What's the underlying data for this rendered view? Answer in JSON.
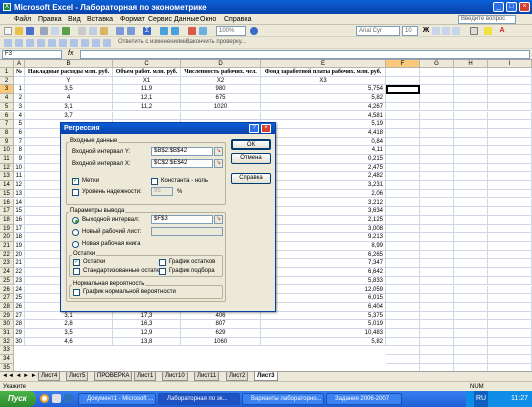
{
  "window": {
    "title": "Microsoft Excel - Лабораторная по эконометрике"
  },
  "menu": [
    "Файл",
    "Правка",
    "Вид",
    "Вставка",
    "Формат",
    "Сервис",
    "Данные",
    "Окно",
    "Справка"
  ],
  "help_placeholder": "Введите вопрос",
  "toolbar": {
    "font": "Arial Cyr",
    "size": "10",
    "review_label": "Ответить с изменениями...",
    "finish_label": "Закончить проверку..."
  },
  "formula": {
    "name_box": "F3",
    "fx": "fx",
    "value": ""
  },
  "columns": [
    "A",
    "B",
    "C",
    "D",
    "E",
    "F",
    "G",
    "H",
    "I"
  ],
  "selected_col": "F",
  "selected_row": 3,
  "header_row": {
    "a": "№",
    "b": "Накладные расходы млн. руб.",
    "c": "Объем работ. млн. руб.",
    "d": "Численность рабочих. чел.",
    "e": "Фонд заработной платы рабочих. млн. руб."
  },
  "var_row": {
    "b": "Y",
    "c": "X1",
    "d": "X2",
    "e": "X3"
  },
  "rows": [
    {
      "r": 3,
      "a": "1",
      "b": "3,5",
      "c": "11,9",
      "d": "980",
      "e": "5,754"
    },
    {
      "r": 4,
      "a": "2",
      "b": "4",
      "c": "12,1",
      "d": "675",
      "e": "5,82"
    },
    {
      "r": 5,
      "a": "3",
      "b": "3,1",
      "c": "11,2",
      "d": "1020",
      "e": "4,267"
    },
    {
      "r": 6,
      "a": "4",
      "b": "3,7",
      "c": "",
      "d": "",
      "e": "4,581"
    },
    {
      "r": 7,
      "a": "5",
      "b": "",
      "c": "",
      "d": "",
      "e": "5,19"
    },
    {
      "r": 8,
      "a": "6",
      "b": "",
      "c": "",
      "d": "",
      "e": "4,418"
    },
    {
      "r": 9,
      "a": "7",
      "b": "",
      "c": "",
      "d": "",
      "e": "0,84"
    },
    {
      "r": 10,
      "a": "8",
      "b": "",
      "c": "",
      "d": "",
      "e": "4,11"
    },
    {
      "r": 11,
      "a": "9",
      "b": "",
      "c": "",
      "d": "",
      "e": "0,215"
    },
    {
      "r": 12,
      "a": "10",
      "b": "",
      "c": "",
      "d": "",
      "e": "2,475"
    },
    {
      "r": 13,
      "a": "11",
      "b": "",
      "c": "",
      "d": "",
      "e": "2,482"
    },
    {
      "r": 14,
      "a": "12",
      "b": "",
      "c": "",
      "d": "",
      "e": "3,231"
    },
    {
      "r": 15,
      "a": "13",
      "b": "",
      "c": "",
      "d": "",
      "e": "2,06"
    },
    {
      "r": 16,
      "a": "14",
      "b": "",
      "c": "",
      "d": "",
      "e": "3,212"
    },
    {
      "r": 17,
      "a": "15",
      "b": "",
      "c": "",
      "d": "",
      "e": "3,634"
    },
    {
      "r": 18,
      "a": "16",
      "b": "",
      "c": "",
      "d": "",
      "e": "2,125"
    },
    {
      "r": 19,
      "a": "17",
      "b": "",
      "c": "",
      "d": "",
      "e": "3,008"
    },
    {
      "r": 20,
      "a": "18",
      "b": "",
      "c": "",
      "d": "",
      "e": "9,213"
    },
    {
      "r": 21,
      "a": "19",
      "b": "",
      "c": "",
      "d": "",
      "e": "8,99"
    },
    {
      "r": 22,
      "a": "20",
      "b": "",
      "c": "",
      "d": "",
      "e": "6,265"
    },
    {
      "r": 23,
      "a": "21",
      "b": "",
      "c": "",
      "d": "",
      "e": "7,347"
    },
    {
      "r": 24,
      "a": "22",
      "b": "",
      "c": "",
      "d": "",
      "e": "6,642"
    },
    {
      "r": 25,
      "a": "23",
      "b": "",
      "c": "",
      "d": "",
      "e": "5,833"
    },
    {
      "r": 26,
      "a": "24",
      "b": "",
      "c": "",
      "d": "",
      "e": "12,059"
    },
    {
      "r": 27,
      "a": "25",
      "b": "3,3",
      "c": "17,1",
      "d": "424",
      "e": "6,015"
    },
    {
      "r": 28,
      "a": "26",
      "b": "2,9",
      "c": "16,2",
      "d": "593",
      "e": "6,404"
    },
    {
      "r": 29,
      "a": "27",
      "b": "3,1",
      "c": "17,3",
      "d": "406",
      "e": "5,375"
    },
    {
      "r": 30,
      "a": "28",
      "b": "2,8",
      "c": "16,3",
      "d": "807",
      "e": "5,019"
    },
    {
      "r": 31,
      "a": "29",
      "b": "3,5",
      "c": "12,9",
      "d": "629",
      "e": "10,483"
    },
    {
      "r": 32,
      "a": "30",
      "b": "4,6",
      "c": "13,8",
      "d": "1060",
      "e": "5,82"
    }
  ],
  "sheet_tabs": [
    "Лист4",
    "Лист5",
    "ПРОВЕРКА",
    "Лист1",
    "Лист10",
    "Лист11",
    "Лист2",
    "Лист3"
  ],
  "active_tab": "Лист3",
  "status": {
    "left": "Укажите",
    "num": "NUM"
  },
  "taskbar": {
    "start": "Пуск",
    "items": [
      "Документ1 - Microsoft ...",
      "Лабораторная по эк...",
      "Варианты лабораторно...",
      "Задания 2006-2007"
    ],
    "active": 1,
    "time": "11:27",
    "lang": "RU"
  },
  "dialog": {
    "title": "Регрессия",
    "input_group": "Входные данные",
    "y_label": "Входной интервал Y:",
    "y_value": "$B$2:$B$42",
    "x_label": "Входной интервал X:",
    "x_value": "$C$2:$E$42",
    "labels_chk": "Метки",
    "labels_checked": true,
    "const_chk": "Константа - ноль",
    "const_checked": false,
    "conf_chk": "Уровень надежности:",
    "conf_checked": false,
    "conf_value": "95",
    "conf_unit": "%",
    "output_group": "Параметры вывода",
    "out_range": "Выходной интервал:",
    "out_value": "$F$3",
    "new_sheet": "Новый рабочий лист:",
    "new_book": "Новая рабочая книга",
    "residuals_group": "Остатки",
    "residuals": "Остатки",
    "residuals_checked": true,
    "std_residuals": "Стандартизованные остатки",
    "residual_plot": "График остатков",
    "line_fit": "График подбора",
    "normal_group": "Нормальная вероятность",
    "normal_plot": "График нормальной вероятности",
    "ok": "ОК",
    "cancel": "Отмена",
    "help": "Справка"
  }
}
